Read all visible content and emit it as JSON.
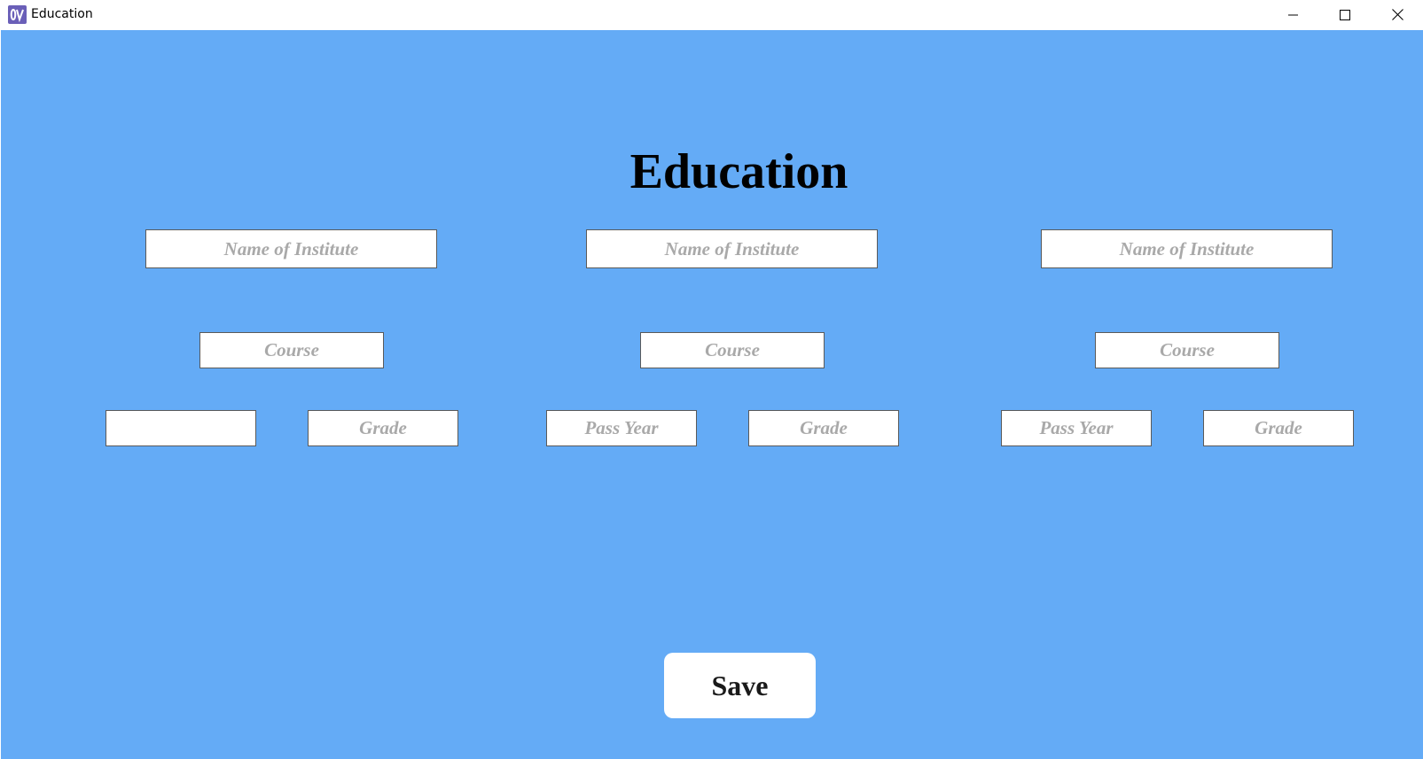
{
  "window": {
    "title": "Education",
    "controls": {
      "minimize_icon": "minimize-icon",
      "maximize_icon": "maximize-icon",
      "close_icon": "close-icon"
    }
  },
  "colors": {
    "background": "#64abf6",
    "field_background": "#ffffff",
    "placeholder": "#a9a9a9",
    "heading": "#000000"
  },
  "heading": "Education",
  "columns": [
    {
      "institute": {
        "value": "",
        "placeholder": "Name of Institute"
      },
      "course": {
        "value": "",
        "placeholder": "Course"
      },
      "pass_year": {
        "value": "",
        "placeholder": ""
      },
      "grade": {
        "value": "",
        "placeholder": "Grade"
      }
    },
    {
      "institute": {
        "value": "",
        "placeholder": "Name of Institute"
      },
      "course": {
        "value": "",
        "placeholder": "Course"
      },
      "pass_year": {
        "value": "",
        "placeholder": "Pass Year"
      },
      "grade": {
        "value": "",
        "placeholder": "Grade"
      }
    },
    {
      "institute": {
        "value": "",
        "placeholder": "Name of Institute"
      },
      "course": {
        "value": "",
        "placeholder": "Course"
      },
      "pass_year": {
        "value": "",
        "placeholder": "Pass Year"
      },
      "grade": {
        "value": "",
        "placeholder": "Grade"
      }
    }
  ],
  "save_label": "Save"
}
